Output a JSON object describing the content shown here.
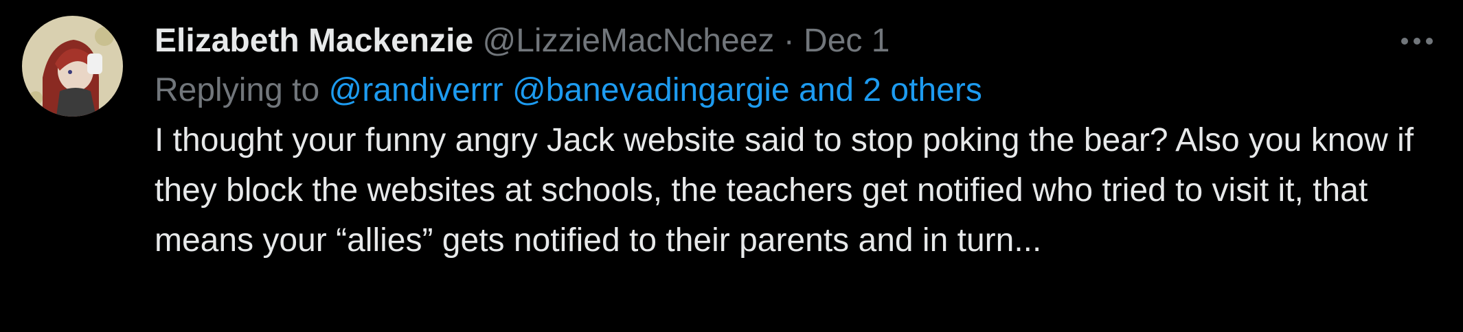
{
  "tweet": {
    "author": {
      "display_name": "Elizabeth Mackenzie",
      "handle": "@LizzieMacNcheez",
      "separator": "·",
      "date": "Dec 1"
    },
    "reply": {
      "prefix": "Replying to",
      "mentions": [
        "@randiverrr",
        "@banevadingargie"
      ],
      "others": "and 2 others"
    },
    "text": "I thought your funny angry Jack website said to stop poking the bear? Also you know if they block the websites at schools, the teachers get notified who tried to visit it, that means your “allies” gets notified to their parents and in turn...",
    "more_icon": "more-horizontal-icon"
  },
  "colors": {
    "background": "#000000",
    "primary_text": "#e7e9ea",
    "secondary_text": "#71767b",
    "link": "#1d9bf0"
  }
}
